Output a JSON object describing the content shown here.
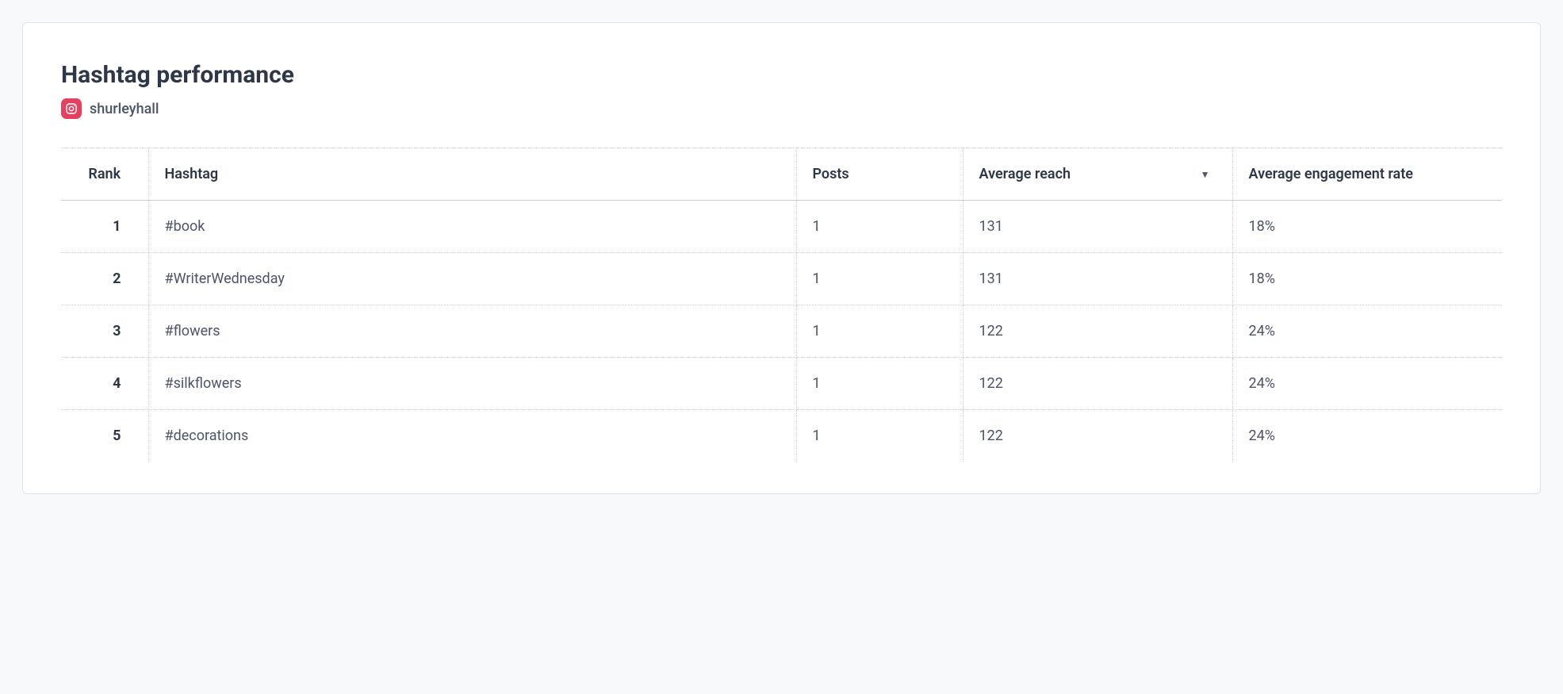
{
  "header": {
    "title": "Hashtag performance",
    "account": "shurleyhall"
  },
  "table": {
    "columns": {
      "rank": "Rank",
      "hashtag": "Hashtag",
      "posts": "Posts",
      "reach": "Average reach",
      "rate": "Average engagement rate"
    },
    "sorted_column": "reach",
    "rows": [
      {
        "rank": "1",
        "hashtag": "#book",
        "posts": "1",
        "reach": "131",
        "rate": "18%"
      },
      {
        "rank": "2",
        "hashtag": "#WriterWednesday",
        "posts": "1",
        "reach": "131",
        "rate": "18%"
      },
      {
        "rank": "3",
        "hashtag": "#flowers",
        "posts": "1",
        "reach": "122",
        "rate": "24%"
      },
      {
        "rank": "4",
        "hashtag": "#silkflowers",
        "posts": "1",
        "reach": "122",
        "rate": "24%"
      },
      {
        "rank": "5",
        "hashtag": "#decorations",
        "posts": "1",
        "reach": "122",
        "rate": "24%"
      }
    ]
  }
}
